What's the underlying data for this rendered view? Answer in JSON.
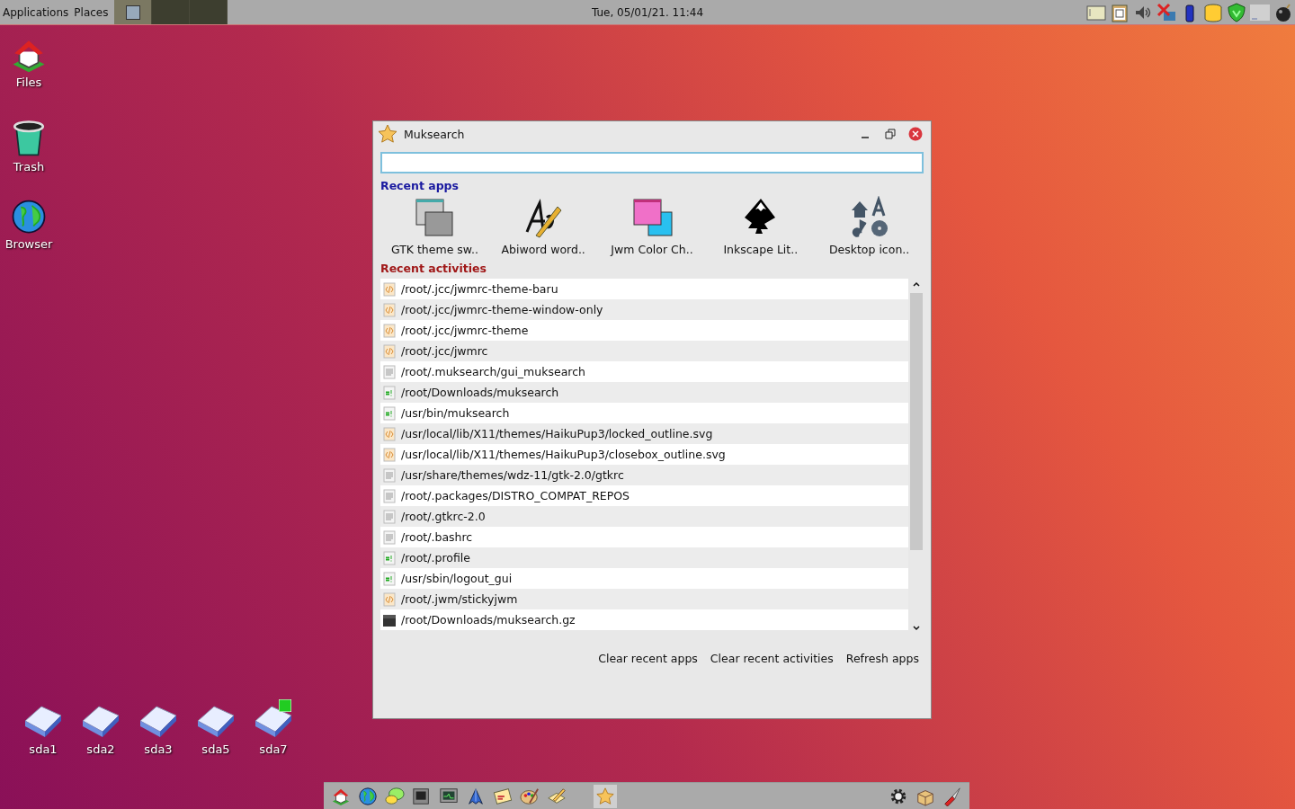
{
  "top_panel": {
    "menus": [
      "Applications",
      "Places"
    ],
    "desktops": [
      {
        "selected": true
      },
      {
        "selected": false
      },
      {
        "selected": false
      }
    ],
    "clock": "Tue, 05/01/21. 11:44"
  },
  "desktop_icons": [
    {
      "kind": "home",
      "label": "Files"
    },
    {
      "kind": "trash",
      "label": "Trash"
    },
    {
      "kind": "globe",
      "label": "Browser"
    }
  ],
  "drives": [
    {
      "label": "sda1",
      "mounted": false
    },
    {
      "label": "sda2",
      "mounted": false
    },
    {
      "label": "sda3",
      "mounted": false
    },
    {
      "label": "sda5",
      "mounted": false
    },
    {
      "label": "sda7",
      "mounted": true
    }
  ],
  "window": {
    "title": "Muksearch",
    "recent_apps_heading": "Recent apps",
    "recent_apps": [
      {
        "kind": "gtk",
        "label": "GTK theme sw.."
      },
      {
        "kind": "abiword",
        "label": "Abiword word.."
      },
      {
        "kind": "jwm",
        "label": "Jwm Color Ch.."
      },
      {
        "kind": "inkscape",
        "label": "Inkscape Lit.."
      },
      {
        "kind": "desktop",
        "label": "Desktop icon.."
      }
    ],
    "recent_activities_heading": "Recent activities",
    "activities": [
      {
        "kind": "code",
        "path": "/root/.jcc/jwmrc-theme-baru"
      },
      {
        "kind": "code",
        "path": "/root/.jcc/jwmrc-theme-window-only"
      },
      {
        "kind": "code",
        "path": "/root/.jcc/jwmrc-theme"
      },
      {
        "kind": "code",
        "path": "/root/.jcc/jwmrc"
      },
      {
        "kind": "text",
        "path": "/root/.muksearch/gui_muksearch"
      },
      {
        "kind": "script",
        "path": "/root/Downloads/muksearch"
      },
      {
        "kind": "script",
        "path": "/usr/bin/muksearch"
      },
      {
        "kind": "code",
        "path": "/usr/local/lib/X11/themes/HaikuPup3/locked_outline.svg"
      },
      {
        "kind": "code",
        "path": "/usr/local/lib/X11/themes/HaikuPup3/closebox_outline.svg"
      },
      {
        "kind": "text",
        "path": "/usr/share/themes/wdz-11/gtk-2.0/gtkrc"
      },
      {
        "kind": "text",
        "path": "/root/.packages/DISTRO_COMPAT_REPOS"
      },
      {
        "kind": "text",
        "path": "/root/.gtkrc-2.0"
      },
      {
        "kind": "text",
        "path": "/root/.bashrc"
      },
      {
        "kind": "script",
        "path": "/root/.profile"
      },
      {
        "kind": "script",
        "path": "/usr/sbin/logout_gui"
      },
      {
        "kind": "code",
        "path": "/root/.jwm/stickyjwm"
      },
      {
        "kind": "archive",
        "path": "/root/Downloads/muksearch.gz"
      }
    ],
    "buttons": [
      "Clear recent apps",
      "Clear recent activities",
      "Refresh apps"
    ]
  },
  "taskbar": {
    "launchers": [
      {
        "kind": "home"
      },
      {
        "kind": "globe"
      },
      {
        "kind": "chat"
      },
      {
        "kind": "terminal"
      },
      {
        "kind": "monitor"
      },
      {
        "kind": "pen"
      },
      {
        "kind": "notes"
      },
      {
        "kind": "paint"
      },
      {
        "kind": "edit"
      }
    ],
    "tasks": [
      {
        "kind": "star",
        "selected": true
      }
    ],
    "tray": [
      {
        "kind": "gear"
      },
      {
        "kind": "package"
      },
      {
        "kind": "knife"
      }
    ]
  }
}
